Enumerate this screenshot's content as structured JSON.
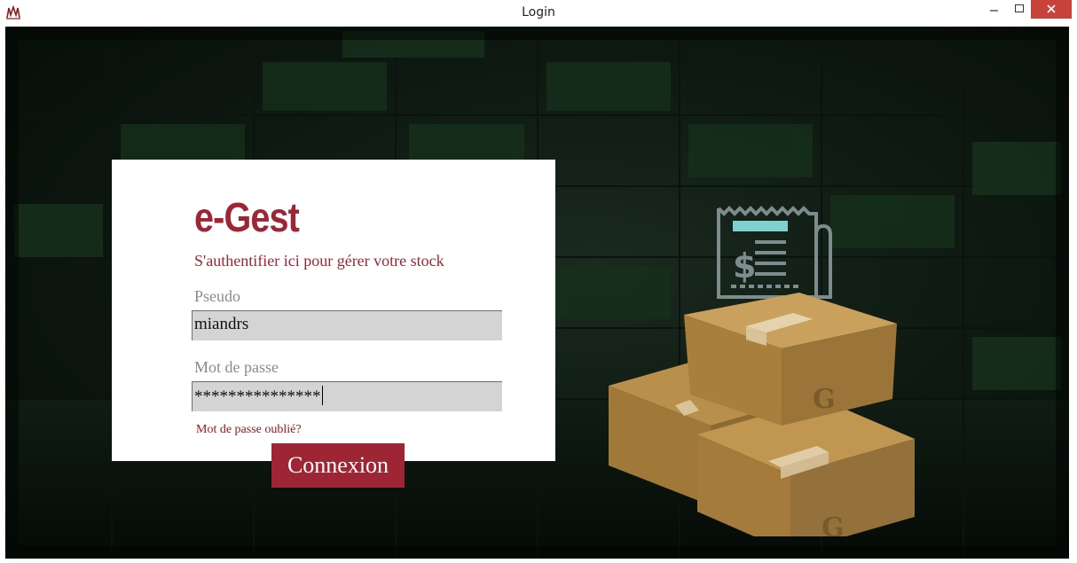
{
  "window": {
    "title": "Login",
    "app_icon": "app-logo-icon",
    "controls": {
      "minimize": "minimize-icon",
      "maximize": "maximize-icon",
      "close": "close-icon",
      "close_color": "#c7423a"
    }
  },
  "login": {
    "brand": "e-Gest",
    "tagline": "S'authentifier ici pour gérer votre stock",
    "username_label": "Pseudo",
    "username_value": "miandrs",
    "password_label": "Mot de passe",
    "password_value": "***************",
    "forgot_link": "Mot de passe oublié?",
    "submit_label": "Connexion",
    "accent_color": "#9e2534"
  },
  "illustration": {
    "icons": [
      "receipt-icon",
      "cardboard-box-icon"
    ]
  }
}
